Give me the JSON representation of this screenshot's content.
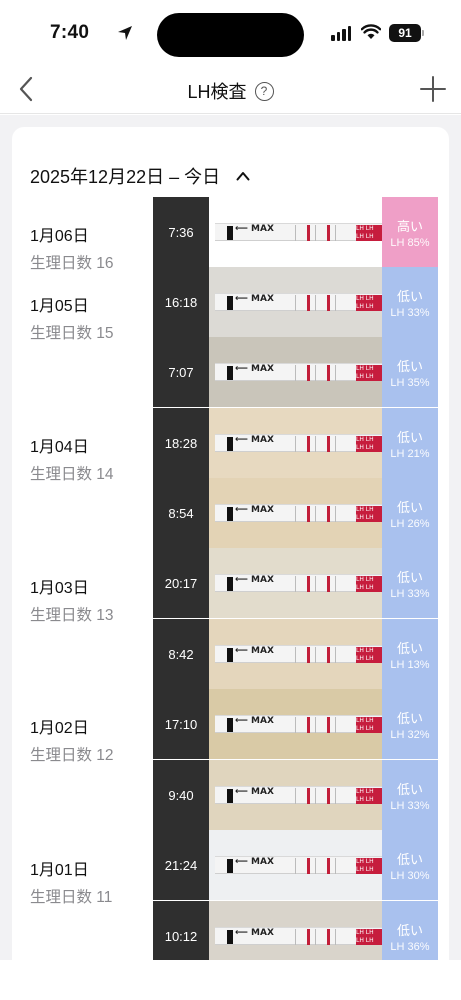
{
  "status": {
    "time": "7:40",
    "battery": "91"
  },
  "nav": {
    "title": "LH検査",
    "help": "?"
  },
  "range": {
    "label": "2025年12月22日 – 今日"
  },
  "days": [
    {
      "date": "1月06日",
      "cycle": "生理日数 16"
    },
    {
      "date": "1月05日",
      "cycle": "生理日数 15"
    },
    {
      "date": "1月04日",
      "cycle": "生理日数 14"
    },
    {
      "date": "1月03日",
      "cycle": "生理日数 13"
    },
    {
      "date": "1月02日",
      "cycle": "生理日数 12"
    },
    {
      "date": "1月01日",
      "cycle": "生理日数 11"
    }
  ],
  "entries": [
    {
      "time": "7:36",
      "level": "高い",
      "lh": "LH 85%",
      "photo_bg": "#ffffff"
    },
    {
      "time": "16:18",
      "level": "低い",
      "lh": "LH 33%",
      "photo_bg": "#dcdad5"
    },
    {
      "time": "7:07",
      "level": "低い",
      "lh": "LH 35%",
      "photo_bg": "#c9c5ba"
    },
    {
      "time": "18:28",
      "level": "低い",
      "lh": "LH 21%",
      "photo_bg": "#e7d9c0"
    },
    {
      "time": "8:54",
      "level": "低い",
      "lh": "LH 26%",
      "photo_bg": "#e3d3b5"
    },
    {
      "time": "20:17",
      "level": "低い",
      "lh": "LH 33%",
      "photo_bg": "#e2dccc"
    },
    {
      "time": "8:42",
      "level": "低い",
      "lh": "LH 13%",
      "photo_bg": "#e4d6bc"
    },
    {
      "time": "17:10",
      "level": "低い",
      "lh": "LH 32%",
      "photo_bg": "#d9caa6"
    },
    {
      "time": "9:40",
      "level": "低い",
      "lh": "LH 33%",
      "photo_bg": "#e0d5be"
    },
    {
      "time": "21:24",
      "level": "低い",
      "lh": "LH 30%",
      "photo_bg": "#eef0f2"
    },
    {
      "time": "10:12",
      "level": "低い",
      "lh": "LH 36%",
      "photo_bg": "#d9d4cb"
    }
  ],
  "strip": {
    "arrow_text": "⟵ MAX",
    "marker_text": "LH LH LH LH LH LH"
  },
  "colors": {
    "high": "#ef9fc7",
    "low": "#a9c1ee",
    "test_line": "#c21f3a"
  }
}
